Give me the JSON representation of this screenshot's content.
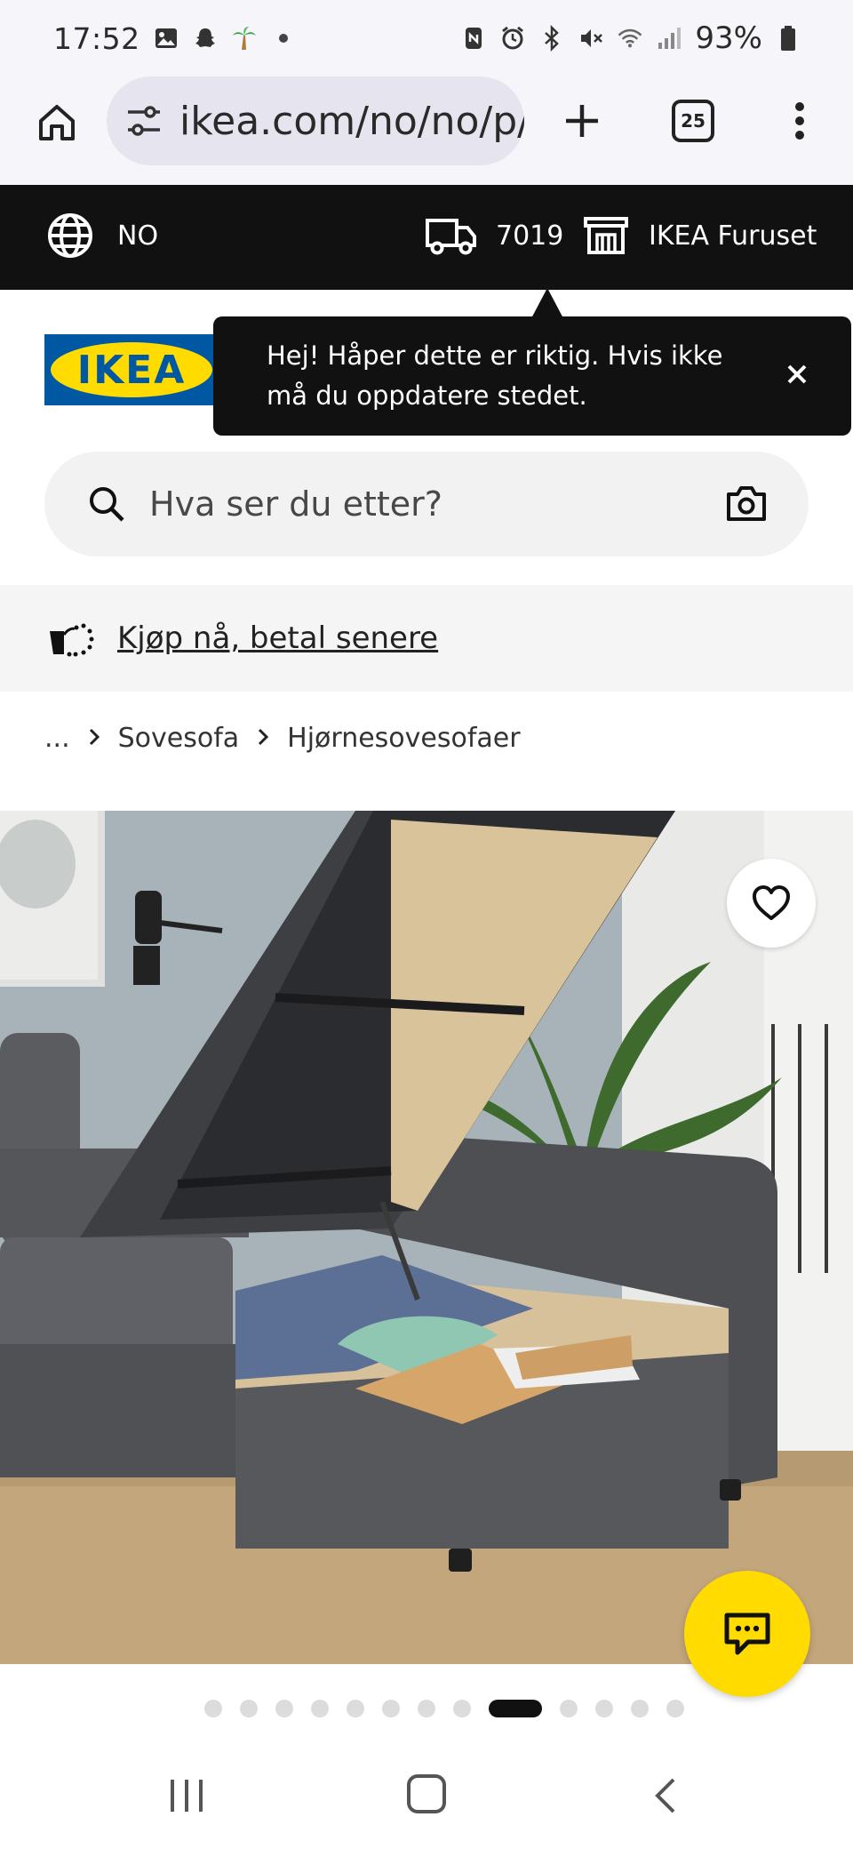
{
  "status_bar": {
    "time": "17:52",
    "battery": "93%",
    "left_icons": [
      "gallery-icon",
      "snapchat-icon",
      "palm-tree-emoji",
      "dot-icon"
    ],
    "right_icons": [
      "nfc-icon",
      "alarm-icon",
      "bluetooth-icon",
      "mute-icon",
      "wifi-icon",
      "signal-icon",
      "battery-icon"
    ]
  },
  "browser": {
    "url": "ikea.com/no/no/p/f",
    "tab_count": "25"
  },
  "ikea_topbar": {
    "language": "NO",
    "postcode": "7019",
    "store": "IKEA Furuset"
  },
  "logo": {
    "text": "IKEA"
  },
  "tooltip": {
    "text": "Hej! Håper dette er riktig. Hvis ikke må du oppdatere stedet."
  },
  "search": {
    "placeholder": "Hva ser du etter?"
  },
  "promo": {
    "text": "Kjøp nå, betal senere"
  },
  "breadcrumb": {
    "items": [
      "...",
      "Sovesofa",
      "Hjørnesovesofaer"
    ]
  },
  "gallery": {
    "dot_count": 13,
    "active_index": 8
  },
  "colors": {
    "ikea_blue": "#0058a3",
    "ikea_yellow": "#ffdb00",
    "topbar": "#111111"
  }
}
